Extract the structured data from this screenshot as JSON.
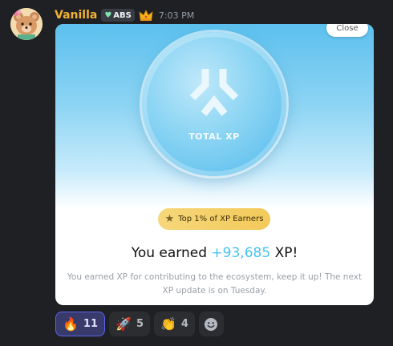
{
  "message": {
    "username": "Vanilla",
    "tag_label": "ABS",
    "tag_icon": "heart-icon",
    "badge_icon": "crown-icon",
    "timestamp": "7:03 PM",
    "avatar": "bear-avatar"
  },
  "card": {
    "close_label": "Close",
    "coin_label": "TOTAL XP",
    "coin_icon": "total-xp-logo-icon",
    "badge_text": "Top 1% of XP Earners",
    "earned_prefix": "You earned",
    "earned_amount": "+93,685",
    "earned_suffix": "XP!",
    "description": "You earned XP for contributing to the ecosystem, keep it up! The next XP update is on Tuesday.",
    "accent_color": "#45c3f0"
  },
  "reactions": [
    {
      "emoji": "🔥",
      "count": "11",
      "active": true
    },
    {
      "emoji": "🚀",
      "count": "5",
      "active": false
    },
    {
      "emoji": "👏",
      "count": "4",
      "active": false
    }
  ],
  "colors": {
    "username": "#f0b232",
    "background": "#1f2024",
    "reaction_active_border": "#5865f2"
  }
}
